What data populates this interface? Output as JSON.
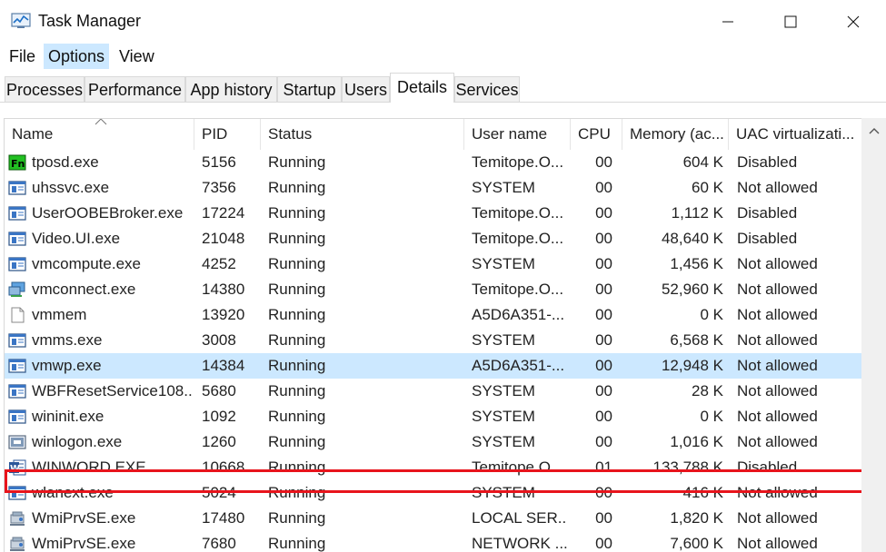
{
  "window": {
    "title": "Task Manager",
    "minimize_symbol": "—",
    "maximize_symbol": "☐",
    "close_symbol": "✕"
  },
  "menu": [
    "File",
    "Options",
    "View"
  ],
  "tabs": [
    "Processes",
    "Performance",
    "App history",
    "Startup",
    "Users",
    "Details",
    "Services"
  ],
  "active_tab": "Details",
  "columns": [
    "Name",
    "PID",
    "Status",
    "User name",
    "CPU",
    "Memory (ac...",
    "UAC virtualizati..."
  ],
  "sort_column": "Name",
  "rows": [
    {
      "name": "tposd.exe",
      "pid": "5156",
      "status": "Running",
      "user": "Temitope.O...",
      "cpu": "00",
      "memory": "604 K",
      "uac": "Disabled",
      "icon": "fn-key-icon"
    },
    {
      "name": "uhssvc.exe",
      "pid": "7356",
      "status": "Running",
      "user": "SYSTEM",
      "cpu": "00",
      "memory": "60 K",
      "uac": "Not allowed",
      "icon": "app-window-icon"
    },
    {
      "name": "UserOOBEBroker.exe",
      "pid": "17224",
      "status": "Running",
      "user": "Temitope.O...",
      "cpu": "00",
      "memory": "1,112 K",
      "uac": "Disabled",
      "icon": "app-window-icon"
    },
    {
      "name": "Video.UI.exe",
      "pid": "21048",
      "status": "Running",
      "user": "Temitope.O...",
      "cpu": "00",
      "memory": "48,640 K",
      "uac": "Disabled",
      "icon": "app-window-icon"
    },
    {
      "name": "vmcompute.exe",
      "pid": "4252",
      "status": "Running",
      "user": "SYSTEM",
      "cpu": "00",
      "memory": "1,456 K",
      "uac": "Not allowed",
      "icon": "app-window-icon"
    },
    {
      "name": "vmconnect.exe",
      "pid": "14380",
      "status": "Running",
      "user": "Temitope.O...",
      "cpu": "00",
      "memory": "52,960 K",
      "uac": "Not allowed",
      "icon": "vm-connect-icon"
    },
    {
      "name": "vmmem",
      "pid": "13920",
      "status": "Running",
      "user": "A5D6A351-...",
      "cpu": "00",
      "memory": "0 K",
      "uac": "Not allowed",
      "icon": "blank-document-icon"
    },
    {
      "name": "vmms.exe",
      "pid": "3008",
      "status": "Running",
      "user": "SYSTEM",
      "cpu": "00",
      "memory": "6,568 K",
      "uac": "Not allowed",
      "icon": "app-window-icon"
    },
    {
      "name": "vmwp.exe",
      "pid": "14384",
      "status": "Running",
      "user": "A5D6A351-...",
      "cpu": "00",
      "memory": "12,948 K",
      "uac": "Not allowed",
      "icon": "app-window-icon",
      "selected": true
    },
    {
      "name": "WBFResetService108...",
      "pid": "5680",
      "status": "Running",
      "user": "SYSTEM",
      "cpu": "00",
      "memory": "28 K",
      "uac": "Not allowed",
      "icon": "app-window-icon"
    },
    {
      "name": "wininit.exe",
      "pid": "1092",
      "status": "Running",
      "user": "SYSTEM",
      "cpu": "00",
      "memory": "0 K",
      "uac": "Not allowed",
      "icon": "app-window-icon"
    },
    {
      "name": "winlogon.exe",
      "pid": "1260",
      "status": "Running",
      "user": "SYSTEM",
      "cpu": "00",
      "memory": "1,016 K",
      "uac": "Not allowed",
      "icon": "winlogon-icon"
    },
    {
      "name": "WINWORD.EXE",
      "pid": "10668",
      "status": "Running",
      "user": "Temitope.O...",
      "cpu": "01",
      "memory": "133,788 K",
      "uac": "Disabled",
      "icon": "word-icon"
    },
    {
      "name": "wlanext.exe",
      "pid": "5024",
      "status": "Running",
      "user": "SYSTEM",
      "cpu": "00",
      "memory": "416 K",
      "uac": "Not allowed",
      "icon": "app-window-icon"
    },
    {
      "name": "WmiPrvSE.exe",
      "pid": "17480",
      "status": "Running",
      "user": "LOCAL SER...",
      "cpu": "00",
      "memory": "1,820 K",
      "uac": "Not allowed",
      "icon": "wmi-icon"
    },
    {
      "name": "WmiPrvSE.exe",
      "pid": "7680",
      "status": "Running",
      "user": "NETWORK ...",
      "cpu": "00",
      "memory": "7,600 K",
      "uac": "Not allowed",
      "icon": "wmi-icon"
    }
  ],
  "colors": {
    "selection": "#cce8ff",
    "highlight_border": "#e8141c",
    "menu_hover": "#cce8ff",
    "word_blue": "#2b579a"
  }
}
